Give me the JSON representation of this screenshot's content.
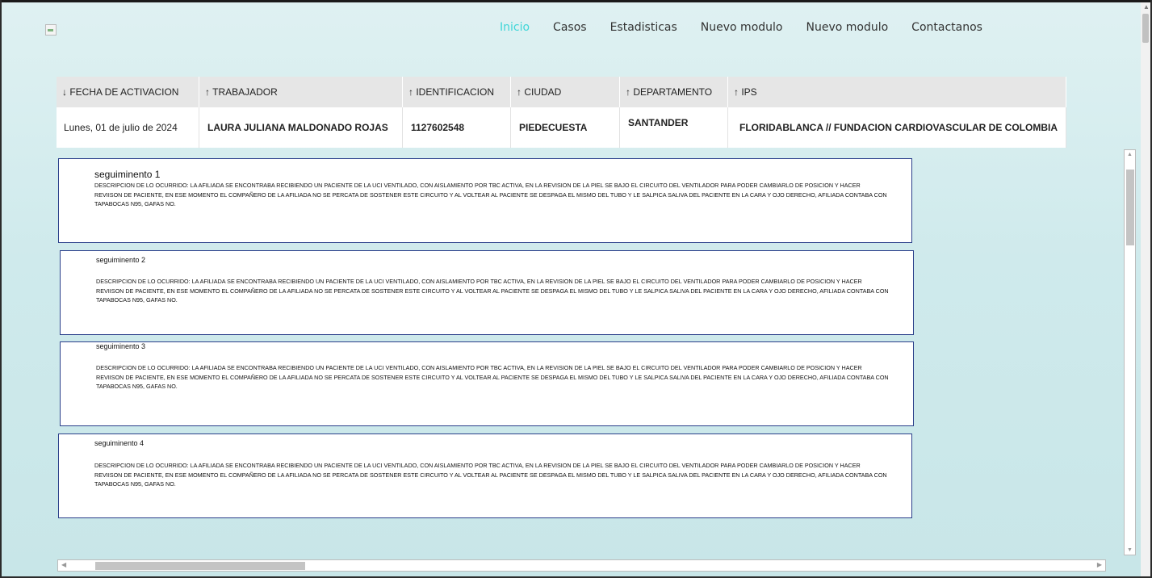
{
  "nav": {
    "items": [
      {
        "label": "Inicio",
        "active": true
      },
      {
        "label": "Casos"
      },
      {
        "label": "Estadisticas"
      },
      {
        "label": "Nuevo modulo"
      },
      {
        "label": "Nuevo modulo"
      },
      {
        "label": "Contactanos"
      }
    ],
    "active_color": "#3fd6d8"
  },
  "table": {
    "headers": [
      "↓ FECHA DE ACTIVACION",
      "↑ TRABAJADOR",
      "↑ IDENTIFICACION",
      "↑ CIUDAD",
      "↑ DEPARTAMENTO",
      "↑ IPS"
    ],
    "row": [
      "Lunes, 01 de  julio de 2024",
      "LAURA JULIANA MALDONADO ROJAS",
      "1127602548",
      "PIEDECUESTA",
      "SANTANDER",
      "FLORIDABLANCA // FUNDACION CARDIOVASCULAR DE COLOMBIA"
    ]
  },
  "followups": [
    {
      "title": "seguiminento 1",
      "description": "DESCRIPCION DE LO OCURRIDO: LA AFILIADA  SE ENCONTRABA RECIBIENDO UN PACIENTE DE LA UCI VENTILADO, CON AISLAMIENTO POR TBC ACTIVA,  EN LA REVISION DE LA PIEL  SE BAJO EL CIRCUITO DEL VENTILADOR PARA PODER CAMBIARLO DE POSICION Y HACER REVIISON DE PACIENTE, EN ESE MOMENTO EL COMPAÑERO DE LA AFILIADA NO SE PERCATA DE SOSTENER ESTE CIRCUITO Y AL VOLTEAR AL PACIENTE SE DESPAGA EL MISMO DEL TUBO Y LE SALPICA SALIVA DEL PACIENTE EN LA CARA Y OJO DERECHO, AFILIADA CONTABA CON TAPABOCAS N95, GAFAS NO."
    },
    {
      "title": "seguiminento 2",
      "description": "DESCRIPCION DE LO OCURRIDO: LA AFILIADA  SE ENCONTRABA RECIBIENDO UN PACIENTE DE LA UCI VENTILADO, CON AISLAMIENTO POR TBC ACTIVA,  EN LA REVISION DE LA PIEL  SE BAJO EL CIRCUITO DEL VENTILADOR PARA PODER CAMBIARLO DE POSICION Y HACER REVIISON DE PACIENTE, EN ESE MOMENTO EL COMPAÑERO DE LA AFILIADA NO SE PERCATA DE SOSTENER ESTE CIRCUITO Y AL VOLTEAR AL PACIENTE SE DESPAGA EL MISMO DEL TUBO Y LE SALPICA SALIVA DEL PACIENTE EN LA CARA Y OJO DERECHO, AFILIADA CONTABA CON TAPABOCAS N95, GAFAS NO."
    },
    {
      "title": "seguiminento 3",
      "description": "DESCRIPCION DE LO OCURRIDO: LA AFILIADA  SE ENCONTRABA RECIBIENDO UN PACIENTE DE LA UCI VENTILADO, CON AISLAMIENTO POR TBC ACTIVA,  EN LA REVISION DE LA PIEL  SE BAJO EL CIRCUITO DEL VENTILADOR PARA PODER CAMBIARLO DE POSICION Y HACER REVIISON DE PACIENTE, EN ESE MOMENTO EL COMPAÑERO DE LA AFILIADA NO SE PERCATA DE SOSTENER ESTE CIRCUITO Y AL VOLTEAR AL PACIENTE SE DESPAGA EL MISMO DEL TUBO Y LE SALPICA SALIVA DEL PACIENTE EN LA CARA Y OJO DERECHO, AFILIADA CONTABA CON TAPABOCAS N95, GAFAS NO."
    },
    {
      "title": "seguiminento 4",
      "description": "DESCRIPCION DE LO OCURRIDO: LA AFILIADA  SE ENCONTRABA RECIBIENDO UN PACIENTE DE LA UCI VENTILADO, CON AISLAMIENTO POR TBC ACTIVA,  EN LA REVISION DE LA PIEL  SE BAJO EL CIRCUITO DEL VENTILADOR PARA PODER CAMBIARLO DE POSICION Y HACER REVIISON DE PACIENTE, EN ESE MOMENTO EL COMPAÑERO DE LA AFILIADA NO SE PERCATA DE SOSTENER ESTE CIRCUITO Y AL VOLTEAR AL PACIENTE SE DESPAGA EL MISMO DEL TUBO Y LE SALPICA SALIVA DEL PACIENTE EN LA CARA Y OJO DERECHO, AFILIADA CONTABA CON TAPABOCAS N95, GAFAS NO."
    }
  ],
  "colors": {
    "card_border": "#2a3f8a"
  }
}
